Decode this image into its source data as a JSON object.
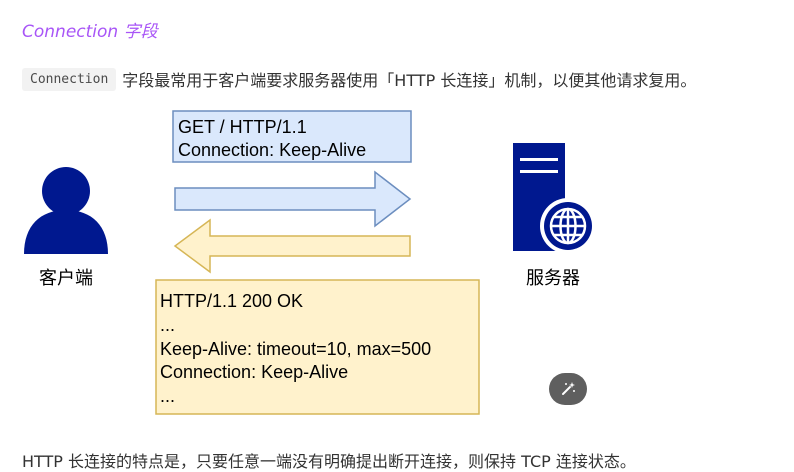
{
  "section": {
    "heading": "Connection 字段"
  },
  "intro": {
    "code": "Connection",
    "text": "字段最常用于客户端要求服务器使用「HTTP 长连接」机制，以便其他请求复用。"
  },
  "diagram": {
    "client_label": "客户端",
    "server_label": "服务器",
    "request": {
      "line1": "GET / HTTP/1.1",
      "line2": "Connection: Keep-Alive"
    },
    "response": {
      "line1": "HTTP/1.1 200 OK",
      "line2": "...",
      "line3": "Keep-Alive: timeout=10, max=500",
      "line4": "Connection: Keep-Alive",
      "line5": "..."
    },
    "colors": {
      "request_fill": "#dae8fc",
      "request_stroke": "#6c8ebf",
      "response_fill": "#fff2cc",
      "response_stroke": "#d6b656",
      "icon_navy": "#00188f"
    }
  },
  "toolbar": {
    "edit_icon": "magic-wand-icon"
  },
  "footer": {
    "text": "HTTP 长连接的特点是，只要任意一端没有明确提出断开连接，则保持 TCP 连接状态。"
  }
}
